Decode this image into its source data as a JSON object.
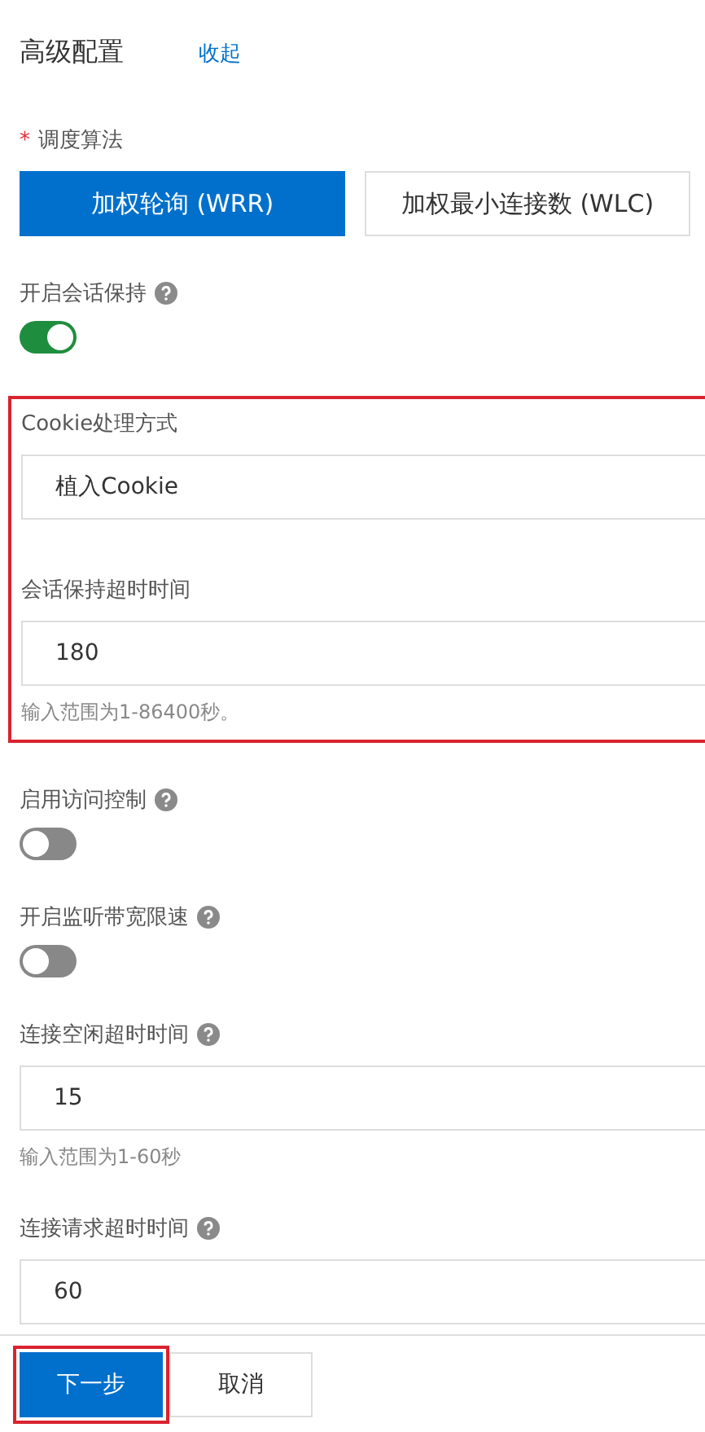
{
  "header": {
    "title": "高级配置",
    "collapse_link": "收起"
  },
  "algorithm": {
    "label": "调度算法",
    "required_mark": "*",
    "options": [
      {
        "label": "加权轮询 (WRR)",
        "selected": true
      },
      {
        "label": "加权最小连接数 (WLC)",
        "selected": false
      }
    ]
  },
  "sections": [
    {
      "kind": "switch",
      "label": "开启会话保持",
      "help": true,
      "on": true
    },
    {
      "kind": "group",
      "highlighted": true,
      "fields": [
        {
          "kind": "input",
          "label": "Cookie处理方式",
          "value": "植入Cookie"
        },
        {
          "kind": "input",
          "label": "会话保持超时时间",
          "value": "180",
          "hint": "输入范围为1-86400秒。"
        }
      ]
    },
    {
      "kind": "switch",
      "label": "启用访问控制",
      "help": true,
      "on": false
    },
    {
      "kind": "switch",
      "label": "开启监听带宽限速",
      "help": true,
      "on": false
    },
    {
      "kind": "input",
      "label": "连接空闲超时时间",
      "help": true,
      "value": "15",
      "hint": "输入范围为1-60秒"
    },
    {
      "kind": "input",
      "label": "连接请求超时时间",
      "help": true,
      "value": "60"
    }
  ],
  "footer": {
    "buttons": [
      {
        "label": "下一步",
        "primary": true,
        "highlighted": true
      },
      {
        "label": "取消",
        "primary": false,
        "highlighted": false
      }
    ]
  }
}
